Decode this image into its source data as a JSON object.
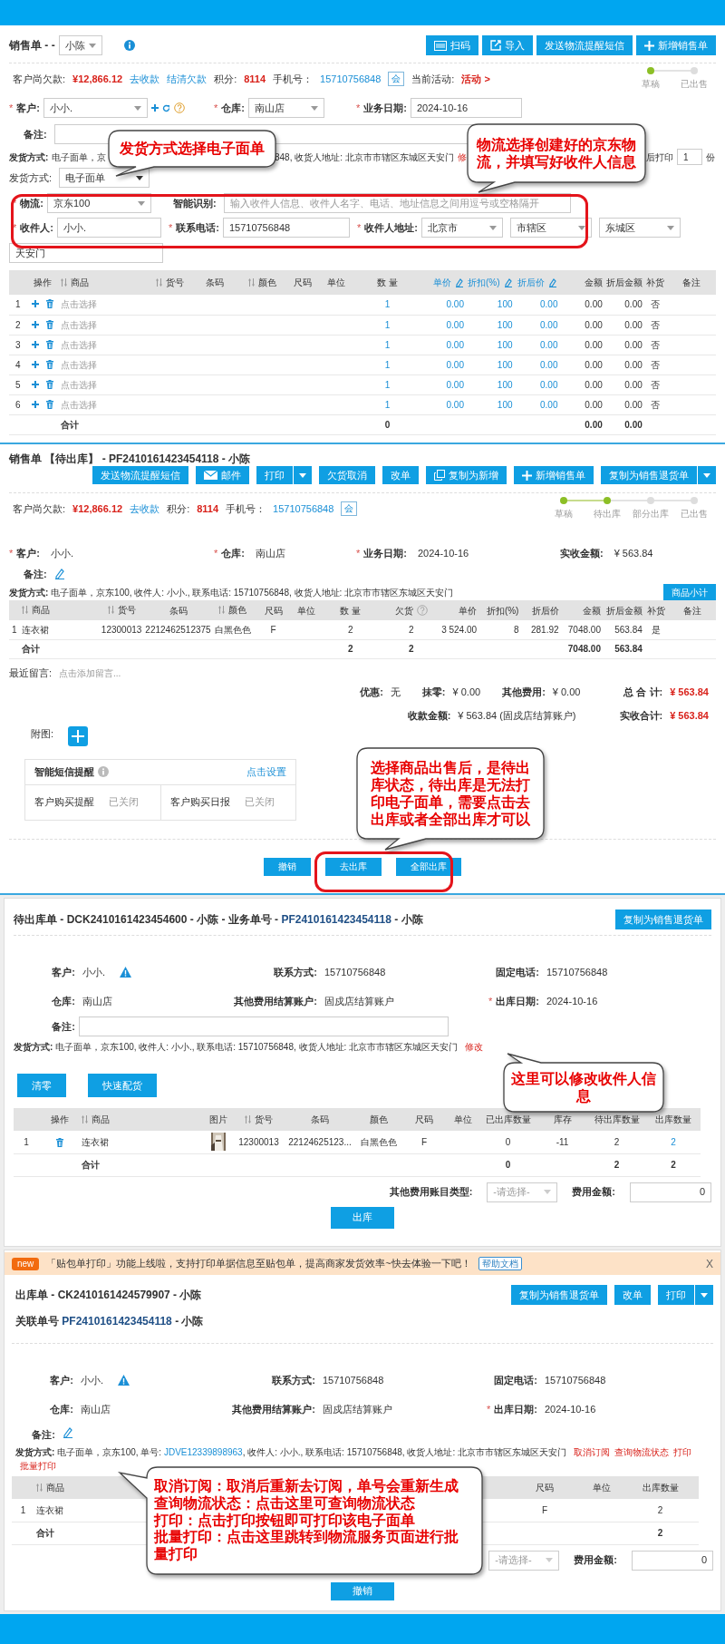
{
  "draft_order": {
    "title": "销售单 - -",
    "salesperson": "小陈",
    "buttons": [
      {
        "label": "扫码"
      },
      {
        "label": "导入"
      },
      {
        "label": "发送物流提醒短信"
      },
      {
        "label": "新增销售单"
      }
    ],
    "summary": [
      {
        "kind": "label",
        "text": "客户尚欠款:"
      },
      {
        "kind": "amount",
        "text": "¥12,866.12"
      },
      {
        "kind": "link",
        "text": "去收款"
      },
      {
        "kind": "link",
        "text": "结清欠款"
      },
      {
        "kind": "label",
        "text": "积分:"
      },
      {
        "kind": "amount",
        "text": "8114"
      },
      {
        "kind": "label",
        "text": "手机号："
      },
      {
        "kind": "phone",
        "text": "15710756848"
      },
      {
        "kind": "badge",
        "text": "会"
      },
      {
        "kind": "label",
        "text": "当前活动:"
      },
      {
        "kind": "activity",
        "text": "活动 >"
      }
    ],
    "steps": [
      {
        "label": "草稿",
        "done": true
      },
      {
        "label": "已出售",
        "done": false
      }
    ],
    "fields": [
      {
        "mark": "*",
        "label": "客户:",
        "value": "小小.",
        "kind": "select"
      },
      {
        "mark": "*",
        "label": "仓库:",
        "value": "南山店",
        "kind": "select"
      },
      {
        "mark": "*",
        "label": "业务日期:",
        "value": "2024-10-16",
        "kind": "input"
      }
    ],
    "remark": {
      "label": "备注:"
    },
    "shipping_line": [
      {
        "kind": "label",
        "text": "发货方式:"
      },
      {
        "kind": "text",
        "text": "电子面单，京"
      },
      {
        "kind": "text",
        "text": "848, 收货人地址: 北京市市辖区东城区天安门"
      },
      {
        "kind": "link",
        "text": "修"
      },
      {
        "kind": "text",
        "text": "后打印"
      },
      {
        "kind": "input",
        "text": "1"
      },
      {
        "kind": "text",
        "text": "份"
      }
    ],
    "shipping_method": {
      "label": "发货方式:",
      "value": "电子面单"
    },
    "logistics": {
      "mark": "*",
      "label": "物流:",
      "value": "京东100"
    },
    "smart_parse": {
      "label": "智能识别:",
      "placeholder": "输入收件人信息、收件人名字、电话、地址信息之间用逗号或空格隔开"
    },
    "recipient": [
      {
        "mark": "*",
        "label": "收件人:",
        "value": "小小.",
        "kind": "input"
      },
      {
        "mark": "*",
        "label": "联系电话:",
        "value": "15710756848",
        "kind": "input"
      },
      {
        "mark": "*",
        "label": "收件人地址:",
        "value": "北京市",
        "kind": "select"
      },
      {
        "value": "市辖区",
        "kind": "select"
      },
      {
        "value": "东城区",
        "kind": "select"
      }
    ],
    "street": "天安门",
    "table": {
      "columns": [
        {
          "label": "操作"
        },
        {
          "label": "商品",
          "sortable": true
        },
        {
          "label": "货号",
          "sortable": true
        },
        {
          "label": "条码"
        },
        {
          "label": "颜色",
          "sortable": true
        },
        {
          "label": "尺码"
        },
        {
          "label": "单位"
        },
        {
          "label": "数 量"
        },
        {
          "label": "单价",
          "editable": true
        },
        {
          "label": "折扣(%)",
          "editable": true
        },
        {
          "label": "折后价",
          "editable": true
        },
        {
          "label": "金额"
        },
        {
          "label": "折后金额"
        },
        {
          "label": "补货"
        },
        {
          "label": "备注"
        }
      ],
      "rows": [
        {
          "index": "1",
          "product": "点击选择",
          "qty": "1",
          "price": "0.00",
          "discount": "100",
          "net_price": "0.00",
          "amount": "0.00",
          "net_amount": "0.00",
          "restock": "否"
        },
        {
          "index": "2",
          "product": "点击选择",
          "qty": "1",
          "price": "0.00",
          "discount": "100",
          "net_price": "0.00",
          "amount": "0.00",
          "net_amount": "0.00",
          "restock": "否"
        },
        {
          "index": "3",
          "product": "点击选择",
          "qty": "1",
          "price": "0.00",
          "discount": "100",
          "net_price": "0.00",
          "amount": "0.00",
          "net_amount": "0.00",
          "restock": "否"
        },
        {
          "index": "4",
          "product": "点击选择",
          "qty": "1",
          "price": "0.00",
          "discount": "100",
          "net_price": "0.00",
          "amount": "0.00",
          "net_amount": "0.00",
          "restock": "否"
        },
        {
          "index": "5",
          "product": "点击选择",
          "qty": "1",
          "price": "0.00",
          "discount": "100",
          "net_price": "0.00",
          "amount": "0.00",
          "net_amount": "0.00",
          "restock": "否"
        },
        {
          "index": "6",
          "product": "点击选择",
          "qty": "1",
          "price": "0.00",
          "discount": "100",
          "net_price": "0.00",
          "amount": "0.00",
          "net_amount": "0.00",
          "restock": "否"
        }
      ],
      "total": {
        "label": "合计",
        "qty": "0",
        "amount": "0.00",
        "net_amount": "0.00"
      }
    }
  },
  "pending_sale": {
    "title": "销售单 【待出库】 - PF2410161423454118 - 小陈",
    "buttons": [
      {
        "label": "发送物流提醒短信",
        "dropdown": false
      },
      {
        "label": "邮件",
        "dropdown": false
      },
      {
        "label": "打印",
        "dropdown": true
      },
      {
        "label": "欠货取消",
        "dropdown": false
      },
      {
        "label": "改单",
        "dropdown": false
      },
      {
        "label": "复制为新增",
        "dropdown": false
      },
      {
        "label": "新增销售单",
        "dropdown": false
      },
      {
        "label": "复制为销售退货单",
        "dropdown": true
      }
    ],
    "summary": [
      {
        "kind": "label",
        "text": "客户尚欠款:"
      },
      {
        "kind": "amount",
        "text": "¥12,866.12"
      },
      {
        "kind": "link",
        "text": "去收款"
      },
      {
        "kind": "label",
        "text": "积分:"
      },
      {
        "kind": "amount",
        "text": "8114"
      },
      {
        "kind": "label",
        "text": "手机号："
      },
      {
        "kind": "phone",
        "text": "15710756848"
      },
      {
        "kind": "badge",
        "text": "会"
      }
    ],
    "steps": [
      {
        "label": "草稿",
        "done": true
      },
      {
        "label": "待出库",
        "done": true
      },
      {
        "label": "部分出库",
        "done": false
      },
      {
        "label": "已出售",
        "done": false
      }
    ],
    "fields": [
      {
        "mark": "*",
        "label": "客户:",
        "value": "小小.",
        "kind": "text"
      },
      {
        "mark": "*",
        "label": "仓库:",
        "value": "南山店",
        "kind": "text"
      },
      {
        "mark": "*",
        "label": "业务日期:",
        "value": "2024-10-16",
        "kind": "text"
      },
      {
        "label": "实收金额:",
        "value": "¥ 563.84",
        "kind": "text"
      }
    ],
    "remark": {
      "label": "备注:",
      "kind": "edit"
    },
    "shipping_line": [
      {
        "kind": "label",
        "text": "发货方式:"
      },
      {
        "kind": "text",
        "text": " 电子面单，京东100, 收件人: 小小., 联系电话: 15710756848, 收货人地址: 北京市市辖区东城区天安门"
      }
    ],
    "subtotal_button": "商品小计",
    "table": {
      "columns": [
        {
          "label": "商品",
          "sortable": true
        },
        {
          "label": "货号",
          "sortable": true
        },
        {
          "label": "条码"
        },
        {
          "label": "颜色",
          "sortable": true
        },
        {
          "label": "尺码"
        },
        {
          "label": "单位"
        },
        {
          "label": "数 量"
        },
        {
          "label": "欠货",
          "help": true
        },
        {
          "label": "单价"
        },
        {
          "label": "折扣(%)"
        },
        {
          "label": "折后价"
        },
        {
          "label": "金额"
        },
        {
          "label": "折后金额"
        },
        {
          "label": "补货"
        },
        {
          "label": "备注"
        }
      ],
      "rows": [
        {
          "index": "1",
          "product": "连衣裙",
          "code": "12300013",
          "barcode": "2212462512375",
          "variant": "白黑色色",
          "size": "F",
          "qty": "2",
          "backorder": "2",
          "price": "3 524.00",
          "discount": "8",
          "net_price": "281.92",
          "amount": "7048.00",
          "net_amount": "563.84",
          "restock": "是"
        }
      ],
      "total": {
        "label": "合计",
        "qty": "2",
        "backorder": "2",
        "amount": "7048.00",
        "net_amount": "563.84"
      }
    },
    "message": {
      "label": "最近留言:",
      "placeholder": "点击添加留言..."
    },
    "totals": [
      [
        {
          "label": "优惠:",
          "value": "无",
          "emphasis": false
        },
        {
          "label": "抹零:",
          "value": "¥ 0.00",
          "emphasis": false
        },
        {
          "label": "其他费用:",
          "value": "¥ 0.00",
          "emphasis": false
        },
        {
          "label": "总 合 计:",
          "value": "¥ 563.84",
          "emphasis": true
        }
      ],
      [
        {
          "label": "收款金额:",
          "value": "¥ 563.84 (固戍店结算账户)",
          "emphasis": false
        },
        {
          "label": "实收合计:",
          "value": "¥ 563.84",
          "emphasis": true
        }
      ]
    ],
    "attachment_label": "附图:",
    "sms": {
      "title": "智能短信提醒",
      "link": "点击设置",
      "items": [
        {
          "label": "客户购买提醒",
          "value": "已关闭"
        },
        {
          "label": "客户购买日报",
          "value": "已关闭"
        }
      ]
    },
    "actions": [
      "撤销",
      "去出库",
      "全部出库"
    ]
  },
  "pending_outbound": {
    "title": [
      {
        "text": "待出库单 - DCK2410161423454600 - 小陈 - 业务单号 - ",
        "link": false
      },
      {
        "text": "PF2410161423454118",
        "link": true
      },
      {
        "text": " - 小陈",
        "link": false
      }
    ],
    "buttons": [
      {
        "label": "复制为销售退货单",
        "dropdown": false
      }
    ],
    "fields": [
      [
        {
          "label": "客户:",
          "value": "小小."
        },
        {
          "label": "联系方式:",
          "value": "15710756848"
        },
        {
          "label": "固定电话:",
          "value": "15710756848"
        }
      ],
      [
        {
          "label": "仓库:",
          "value": "南山店"
        },
        {
          "label": "其他费用结算账户:",
          "value": "固戍店结算账户"
        },
        {
          "mark": "*",
          "label": "出库日期:",
          "value": "2024-10-16"
        }
      ]
    ],
    "remark": {
      "label": "备注:",
      "kind": "input"
    },
    "shipping_line": [
      {
        "kind": "label",
        "text": "发货方式:"
      },
      {
        "kind": "text",
        "text": " 电子面单，京东100, 收件人: 小小., 联系电话: 15710756848, 收货人地址: 北京市市辖区东城区天安门 "
      },
      {
        "kind": "action",
        "text": "修改"
      }
    ],
    "tool_buttons": [
      "清零",
      "快速配货"
    ],
    "table": {
      "columns": [
        {
          "label": "操作"
        },
        {
          "label": "商品",
          "sortable": true
        },
        {
          "label": "图片"
        },
        {
          "label": "货号",
          "sortable": true
        },
        {
          "label": "条码"
        },
        {
          "label": "颜色"
        },
        {
          "label": "尺码"
        },
        {
          "label": "单位"
        },
        {
          "label": "已出库数量"
        },
        {
          "label": "库存"
        },
        {
          "label": "待出库数量"
        },
        {
          "label": "出库数量"
        }
      ],
      "rows": [
        {
          "index": "1",
          "product": "连衣裙",
          "code": "12300013",
          "barcode": "22124625123...",
          "variant": "白黑色色",
          "size": "F",
          "shipped": "0",
          "stock": "-11",
          "pending": "2",
          "out_qty": "2"
        }
      ],
      "total": {
        "label": "合计",
        "shipped": "0",
        "pending": "2",
        "out_qty": "2"
      }
    },
    "fee": {
      "type_label": "其他费用账目类型:",
      "type_placeholder": "-请选择-",
      "amount_label": "费用金额:",
      "amount": "0"
    },
    "submit": "出库"
  },
  "outbound": {
    "notice": {
      "badge": "new",
      "text": "「贴包单打印」功能上线啦，支持打印单据信息至贴包单，提高商家发货效率~快去体验一下吧！",
      "help": "帮助文档",
      "close": "X"
    },
    "title": "出库单 - CK2410161424579907 - 小陈",
    "buttons": [
      {
        "label": "复制为销售退货单",
        "dropdown": false
      },
      {
        "label": "改单",
        "dropdown": false
      },
      {
        "label": "打印",
        "dropdown": true
      }
    ],
    "related": [
      {
        "text": "关联单号 ",
        "link": false
      },
      {
        "text": "PF2410161423454118",
        "link": true
      },
      {
        "text": " - 小陈",
        "link": false
      }
    ],
    "fields": [
      [
        {
          "label": "客户:",
          "value": "小小."
        },
        {
          "label": "联系方式:",
          "value": "15710756848"
        },
        {
          "label": "固定电话:",
          "value": "15710756848"
        }
      ],
      [
        {
          "label": "仓库:",
          "value": "南山店"
        },
        {
          "label": "其他费用结算账户:",
          "value": "固戍店结算账户"
        },
        {
          "mark": "*",
          "label": "出库日期:",
          "value": "2024-10-16"
        }
      ]
    ],
    "remark": {
      "label": "备注:",
      "kind": "edit"
    },
    "shipping_line": [
      {
        "kind": "label",
        "text": "发货方式:"
      },
      {
        "kind": "text",
        "text": " 电子面单，京东100, 单号: "
      },
      {
        "kind": "number",
        "text": "JDVE12339898963"
      },
      {
        "kind": "text",
        "text": ", 收件人: 小小., 联系电话: 15710756848, 收货人地址: 北京市市辖区东城区天安门 "
      },
      {
        "kind": "action",
        "text": "取消订阅"
      },
      {
        "kind": "action",
        "text": "查询物流状态"
      },
      {
        "kind": "action",
        "text": "打印"
      },
      {
        "kind": "action",
        "text": "批量打印"
      }
    ],
    "table": {
      "columns": [
        {
          "label": "商品",
          "sortable": true
        },
        {
          "label": "尺码"
        },
        {
          "label": "单位"
        },
        {
          "label": "出库数量"
        }
      ],
      "rows": [
        {
          "index": "1",
          "product": "连衣裙",
          "size": "F",
          "out_qty": "2"
        }
      ],
      "total": {
        "label": "合计",
        "out_qty": "2"
      }
    },
    "fee": {
      "type_placeholder": "-请选择-",
      "amount_label": "费用金额:",
      "amount": "0"
    },
    "submit": "撤销"
  },
  "annotations": [
    {
      "text": "发货方式选择电子面单"
    },
    {
      "text": "物流选择创建好的京东物流，并填写好收件人信息"
    },
    {
      "text": "选择商品出售后，是待出库状态，待出库是无法打印电子面单，需要点击去出库或者全部出库才可以"
    },
    {
      "text": "这里可以修改收件人信息"
    },
    {
      "lines": [
        "取消订阅：取消后重新去订阅，单号会重新生成",
        "查询物流状态：点击这里可查询物流状态",
        "打印：点击打印按钮即可打印该电子面单",
        "批量打印：点击这里跳转到物流服务页面进行批量打印"
      ]
    }
  ]
}
